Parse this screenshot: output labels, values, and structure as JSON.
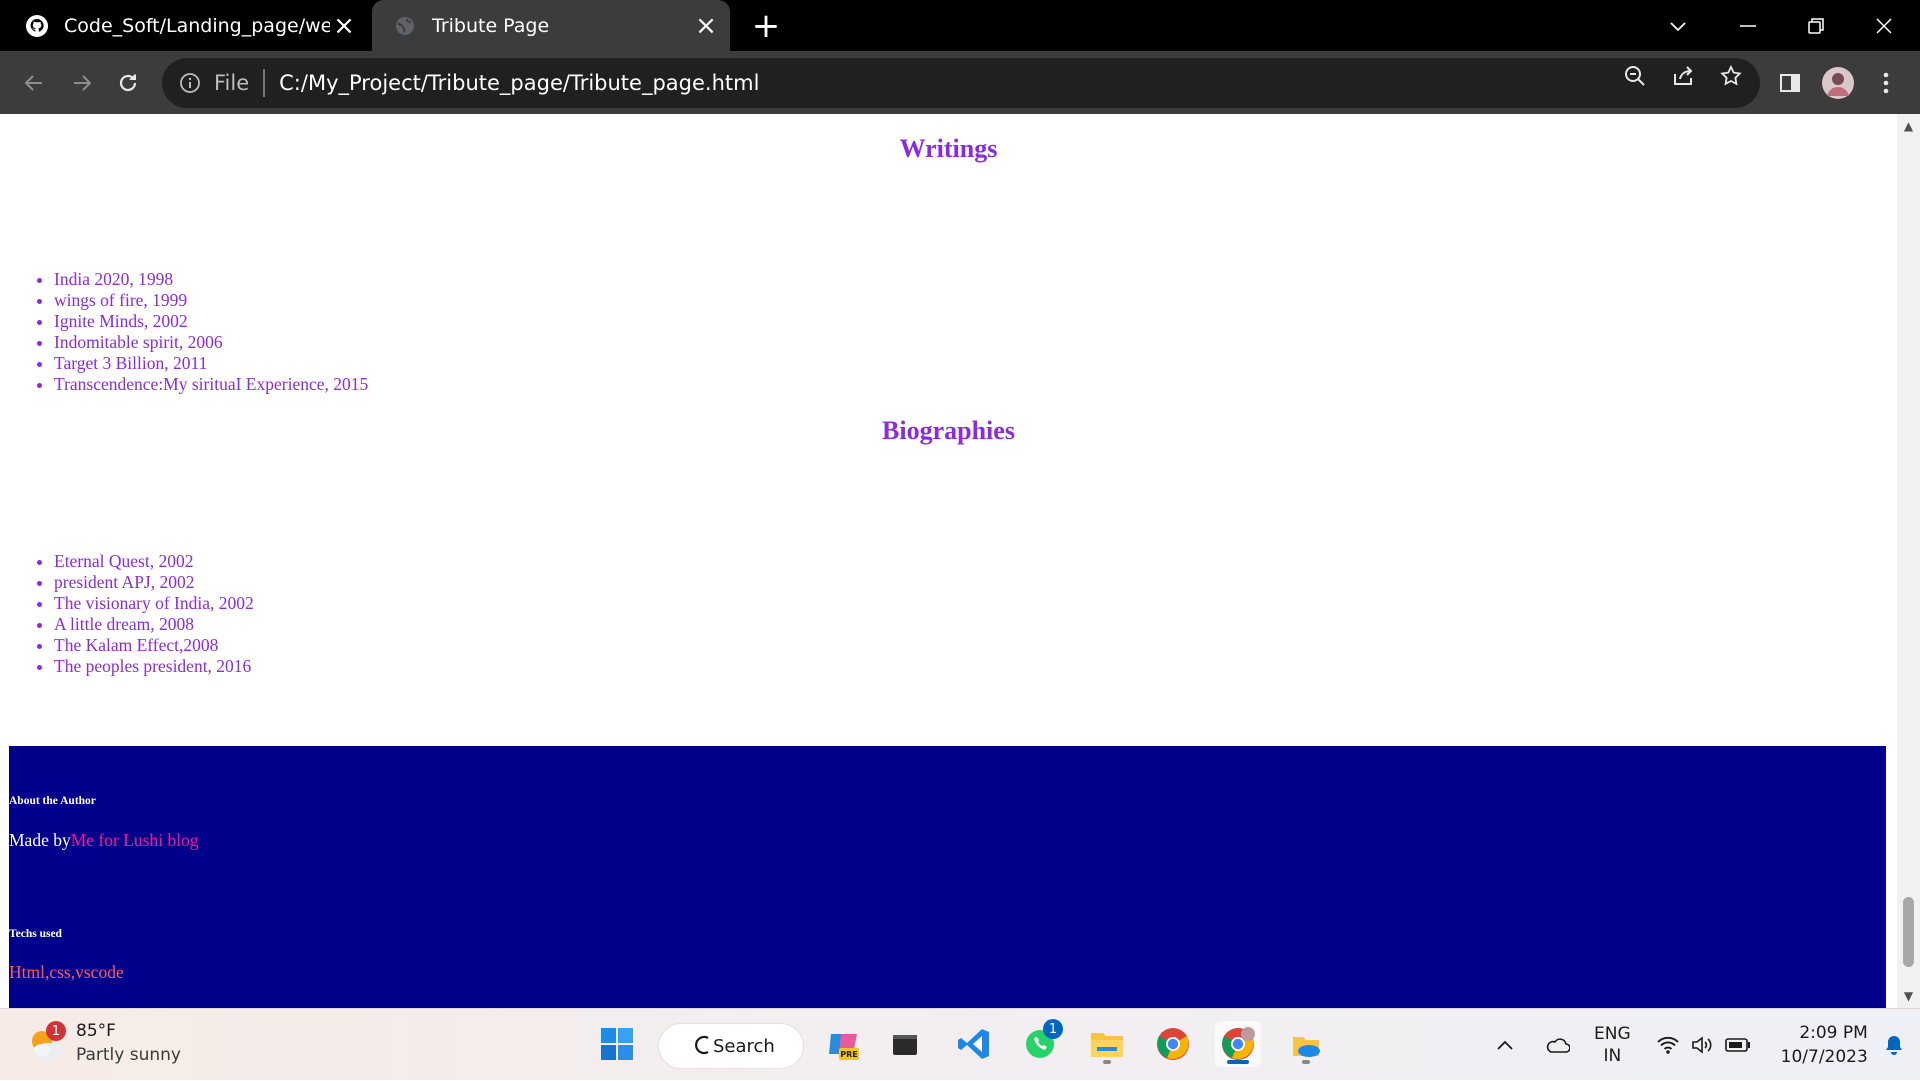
{
  "browser": {
    "tabs": [
      {
        "title": "Code_Soft/Landing_page/web_S",
        "icon": "github-icon",
        "active": false
      },
      {
        "title": "Tribute Page",
        "icon": "globe-icon",
        "active": true
      }
    ],
    "address": {
      "scheme": "File",
      "url": "C:/My_Project/Tribute_page/Tribute_page.html"
    }
  },
  "page": {
    "writings": {
      "title": "Writings",
      "items": [
        "India 2020, 1998",
        "wings of fire, 1999",
        "Ignite Minds, 2002",
        "Indomitable spirit, 2006",
        "Target 3 Billion, 2011",
        "Transcendence:My sirituaI Experience, 2015"
      ]
    },
    "biographies": {
      "title": "Biographies",
      "items": [
        "Eternal Quest, 2002",
        "president APJ, 2002",
        "The visionary of India, 2002",
        "A little dream, 2008",
        "The Kalam Effect,2008",
        "The peoples president, 2016"
      ]
    },
    "footer": {
      "about_heading": "About the Author",
      "made_by_label": "Made by",
      "made_by_link": "Me for Lushi blog",
      "techs_heading": "Techs used",
      "techs_value": "Html,css,vscode"
    }
  },
  "taskbar": {
    "weather": {
      "temp": "85°F",
      "condition": "Partly sunny",
      "badge": "1"
    },
    "search_label": "Search",
    "whatsapp_badge": "1",
    "language": {
      "line1": "ENG",
      "line2": "IN"
    },
    "clock": {
      "time": "2:09 PM",
      "date": "10/7/2023"
    }
  },
  "colors": {
    "heading": "#8a2be2",
    "list_text": "#8a2be2",
    "footer_bg": "#00008b",
    "link": "#ff1493"
  }
}
